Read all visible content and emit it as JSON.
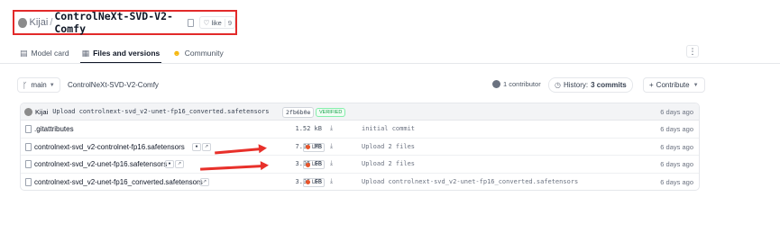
{
  "header": {
    "owner": "Kijai",
    "separator": "/",
    "repo": "ControlNeXt-SVD-V2-Comfy",
    "like_label": "like",
    "like_count": "9"
  },
  "tabs": [
    {
      "label": "Model card",
      "icon": "model-card-icon"
    },
    {
      "label": "Files and versions",
      "icon": "files-icon",
      "active": true
    },
    {
      "label": "Community",
      "icon": "community-icon"
    }
  ],
  "more_label": "⋮",
  "branch": {
    "name": "main",
    "path": "ControlNeXt-SVD-V2-Comfy"
  },
  "contributors": "1 contributor",
  "history": {
    "prefix": "History:",
    "commits": "3 commits"
  },
  "contribute_label": "Contribute",
  "last_commit": {
    "author": "Kijai",
    "message": "Upload controlnext-svd_v2-unet-fp16_converted.safetensors",
    "hash": "2fb6b0e",
    "verified": "VERIFIED",
    "time": "6 days ago"
  },
  "files": [
    {
      "name": ".gitattributes",
      "size": "1.52 kB",
      "lfs": "",
      "message": "initial commit",
      "time": "6 days ago"
    },
    {
      "name": "controlnext-svd_v2-controlnet-fp16.safetensors",
      "size": "7.06 MB",
      "lfs": "LFS",
      "message": "Upload 2 files",
      "time": "6 days ago"
    },
    {
      "name": "controlnext-svd_v2-unet-fp16.safetensors",
      "size": "3.05 GB",
      "lfs": "LFS",
      "message": "Upload 2 files",
      "time": "6 days ago"
    },
    {
      "name": "controlnext-svd_v2-unet-fp16_converted.safetensors",
      "size": "3.05 GB",
      "lfs": "LFS",
      "message": "Upload controlnext-svd_v2-unet-fp16_converted.safetensors",
      "time": "6 days ago"
    }
  ],
  "colors": {
    "highlight": "#e22a2a",
    "arrow": "#e8302a",
    "lfs_dot": "#e8542a",
    "verified": "#16a34a"
  }
}
